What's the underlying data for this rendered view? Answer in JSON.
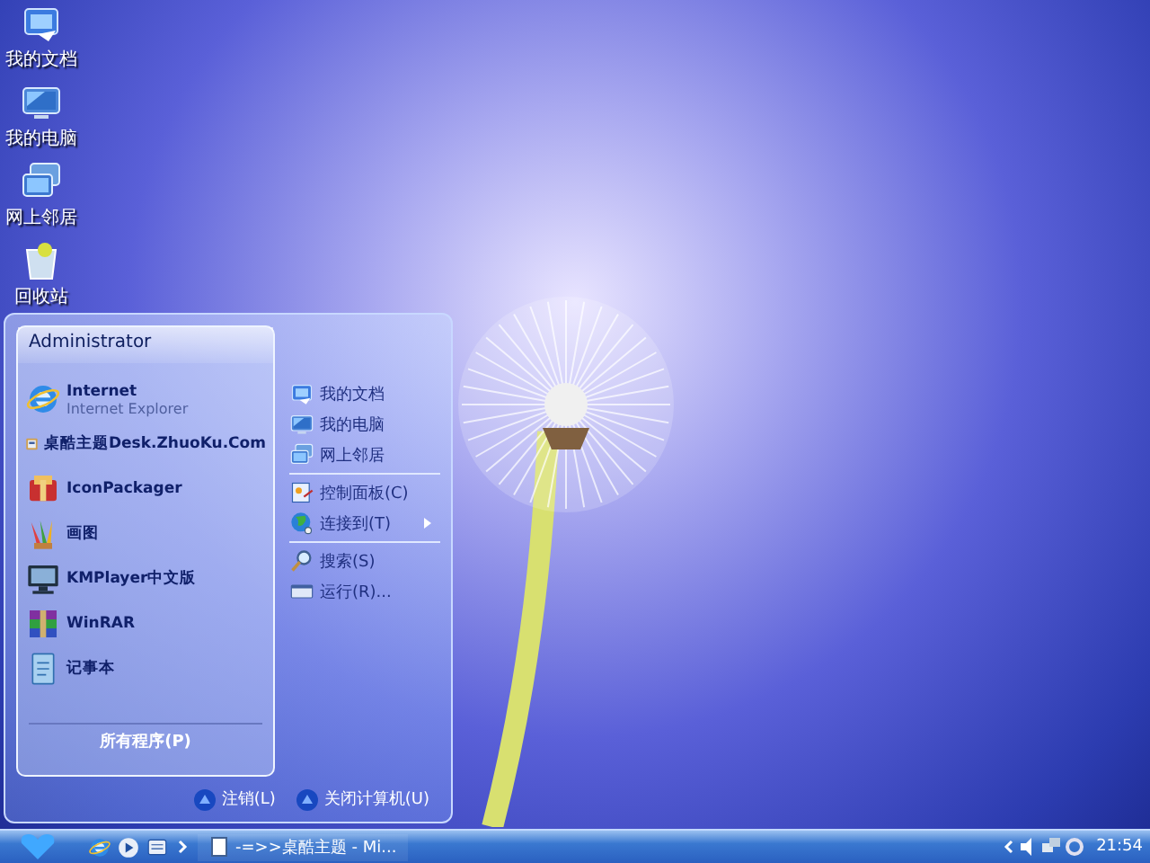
{
  "desktop_icons": [
    {
      "label": "我的文档",
      "kind": "documents"
    },
    {
      "label": "我的电脑",
      "kind": "computer"
    },
    {
      "label": "网上邻居",
      "kind": "network"
    },
    {
      "label": "回收站",
      "kind": "recycle"
    }
  ],
  "start_menu": {
    "user": "Administrator",
    "programs": [
      {
        "name": "Internet",
        "subtitle": "Internet Explorer",
        "kind": "ie"
      },
      {
        "name": "桌酷主题Desk.ZhuoKu.Com",
        "kind": "theme"
      },
      {
        "name": "IconPackager",
        "kind": "package"
      },
      {
        "name": "画图",
        "kind": "paint"
      },
      {
        "name": "KMPlayer中文版",
        "kind": "player"
      },
      {
        "name": "WinRAR",
        "kind": "archive"
      },
      {
        "name": "记事本",
        "kind": "notepad"
      }
    ],
    "all_programs": "所有程序(P)",
    "places": [
      [
        {
          "label": "我的文档",
          "kind": "documents",
          "submenu": false
        },
        {
          "label": "我的电脑",
          "kind": "computer",
          "submenu": false
        },
        {
          "label": "网上邻居",
          "kind": "network",
          "submenu": false
        }
      ],
      [
        {
          "label": "控制面板(C)",
          "kind": "control",
          "submenu": false
        },
        {
          "label": "连接到(T)",
          "kind": "globe",
          "submenu": true
        }
      ],
      [
        {
          "label": "搜索(S)",
          "kind": "search",
          "submenu": false
        },
        {
          "label": "运行(R)...",
          "kind": "run",
          "submenu": false
        }
      ]
    ],
    "logoff": "注销(L)",
    "shutdown": "关闭计算机(U)"
  },
  "taskbar": {
    "quick_launch": [
      {
        "kind": "ie"
      },
      {
        "kind": "media"
      },
      {
        "kind": "desktop"
      }
    ],
    "task": "-=>>桌酷主题 - Mi...",
    "clock": "21:54"
  }
}
